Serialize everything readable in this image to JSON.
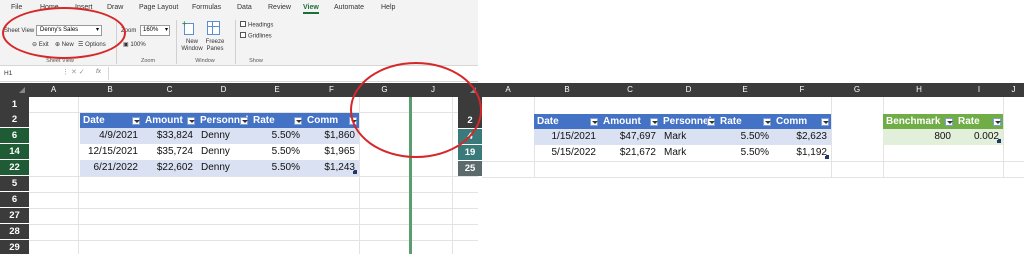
{
  "ribbon": {
    "tabs": [
      "File",
      "Home",
      "Insert",
      "Draw",
      "Page Layout",
      "Formulas",
      "Data",
      "Review",
      "View",
      "Automate",
      "Help"
    ],
    "active_tab": "View",
    "sheet_view_label": "Sheet View",
    "sheet_view_value": "Denny's Sales",
    "exit_label": "Exit",
    "new_label": "New",
    "options_label": "Options",
    "sheet_view_group": "Sheet View",
    "zoom_label": "Zoom",
    "zoom_value": "160%",
    "hundred_label": "100%",
    "zoom_group": "Zoom",
    "new_window_label": "New Window",
    "freeze_label": "Freeze Panes",
    "window_group": "Window",
    "headings_label": "Headings",
    "gridlines_label": "Gridlines",
    "show_group": "Show"
  },
  "formula_bar": {
    "name_box": "H1",
    "fx": "fx"
  },
  "left_pane": {
    "columns": [
      "A",
      "B",
      "C",
      "D",
      "E",
      "F",
      "G",
      "J"
    ],
    "rows": [
      "1",
      "2",
      "6",
      "14",
      "22",
      "5",
      "6",
      "27",
      "28",
      "29"
    ],
    "table": {
      "headers": [
        "Date",
        "Amount",
        "Personnel",
        "Rate",
        "Comm"
      ],
      "rows": [
        [
          "4/9/2021",
          "$33,824",
          "Denny",
          "5.50%",
          "$1,860"
        ],
        [
          "12/15/2021",
          "$35,724",
          "Denny",
          "5.50%",
          "$1,965"
        ],
        [
          "6/21/2022",
          "$22,602",
          "Denny",
          "5.50%",
          "$1,243"
        ]
      ]
    }
  },
  "right_pane": {
    "columns": [
      "A",
      "B",
      "C",
      "D",
      "E",
      "F",
      "G",
      "H",
      "I",
      "J"
    ],
    "rows": [
      "2",
      "4",
      "19",
      "25"
    ],
    "table": {
      "headers": [
        "Date",
        "Amount",
        "Personnel",
        "Rate",
        "Comm"
      ],
      "rows": [
        [
          "1/15/2021",
          "$47,697",
          "Mark",
          "5.50%",
          "$2,623"
        ],
        [
          "5/15/2022",
          "$21,672",
          "Mark",
          "5.50%",
          "$1,192"
        ]
      ]
    },
    "side_table": {
      "headers": [
        "Benchmark",
        "Rate"
      ],
      "row": [
        "800",
        "0.002"
      ]
    }
  },
  "colors": {
    "header_blue": "#4472c4",
    "band_blue": "#d9e1f2",
    "header_green": "#70ad47",
    "band_green": "#e2efda",
    "annotation_red": "#d62828",
    "freeze_line": "#5a9e6f"
  }
}
